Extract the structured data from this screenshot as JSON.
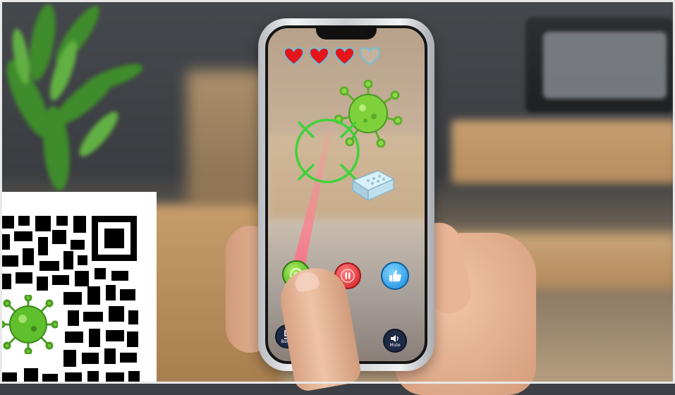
{
  "game": {
    "hearts": [
      {
        "state": "full"
      },
      {
        "state": "full"
      },
      {
        "state": "full"
      },
      {
        "state": "empty"
      }
    ],
    "colors": {
      "heart_full": "#e5161b",
      "heart_outline": "#6fc1d9",
      "crosshair": "#3fd23a",
      "virus": "#7fd13b",
      "fire_button": "#5fbf24",
      "pause_button": "#e02a2f",
      "like_button": "#2ea5ef",
      "bottom_button": "#1e2a45",
      "laser": "#ff7a8a"
    },
    "buttons": {
      "fire_icon": "target-icon",
      "pause_icon": "pause-icon",
      "like_icon": "thumbs-up-icon",
      "boost_icon": "boost-icon",
      "boost_label": "Boost",
      "mute_icon": "speaker-icon",
      "mute_label": "Mute"
    }
  },
  "overlay": {
    "qr_icon": "qr-code",
    "qr_logo_icon": "virus-icon"
  }
}
